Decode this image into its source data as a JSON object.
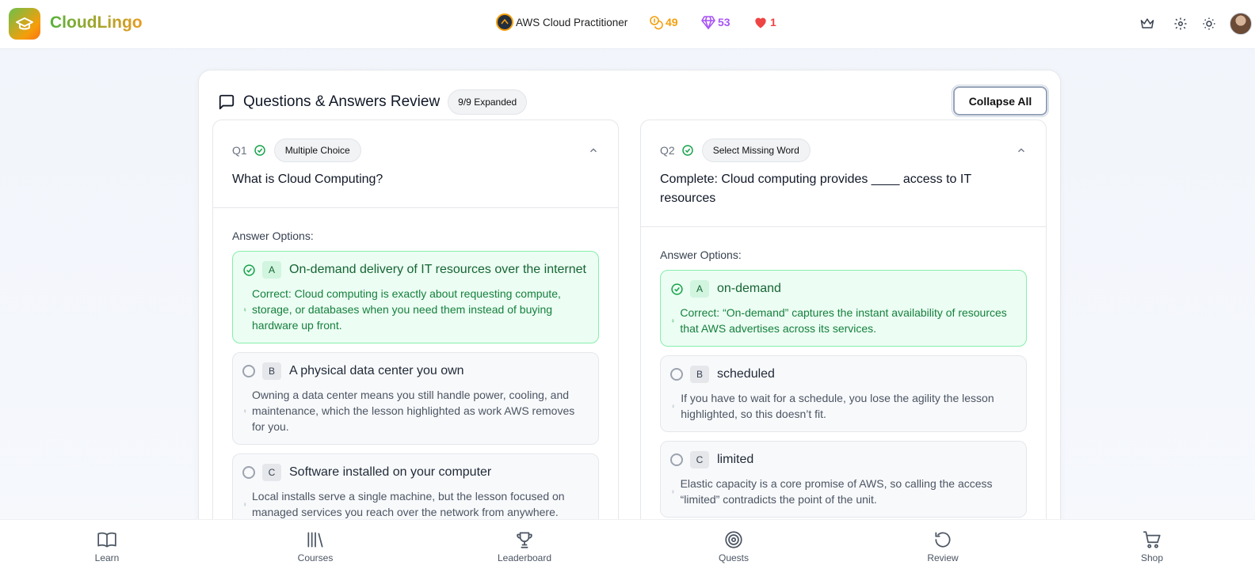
{
  "app": {
    "name": "CloudLingo"
  },
  "header": {
    "course": "AWS Cloud Practitioner",
    "coins": "49",
    "gems": "53",
    "hearts": "1"
  },
  "review": {
    "title": "Questions & Answers Review",
    "expanded_badge": "9/9 Expanded",
    "collapse_label": "Collapse All",
    "answers_label": "Answer Options:"
  },
  "questions": [
    {
      "num": "Q1",
      "type": "Multiple Choice",
      "text": "What is Cloud Computing?",
      "options": [
        {
          "letter": "A",
          "text": "On-demand delivery of IT resources over the internet",
          "correct": true,
          "explanation": "Correct: Cloud computing is exactly about requesting compute, storage, or databases when you need them instead of buying hardware up front."
        },
        {
          "letter": "B",
          "text": "A physical data center you own",
          "correct": false,
          "explanation": "Owning a data center means you still handle power, cooling, and maintenance, which the lesson highlighted as work AWS removes for you."
        },
        {
          "letter": "C",
          "text": "Software installed on your computer",
          "correct": false,
          "explanation": "Local installs serve a single machine, but the lesson focused on managed services you reach over the network from anywhere."
        }
      ]
    },
    {
      "num": "Q2",
      "type": "Select Missing Word",
      "text": "Complete: Cloud computing provides ____ access to IT resources",
      "options": [
        {
          "letter": "A",
          "text": "on-demand",
          "correct": true,
          "explanation": "Correct: “On-demand” captures the instant availability of resources that AWS advertises across its services."
        },
        {
          "letter": "B",
          "text": "scheduled",
          "correct": false,
          "explanation": "If you have to wait for a schedule, you lose the agility the lesson highlighted, so this doesn’t fit."
        },
        {
          "letter": "C",
          "text": "limited",
          "correct": false,
          "explanation": "Elastic capacity is a core promise of AWS, so calling the access “limited” contradicts the point of the unit."
        }
      ]
    }
  ],
  "nav": [
    {
      "label": "Learn",
      "icon": "book-icon"
    },
    {
      "label": "Courses",
      "icon": "library-icon"
    },
    {
      "label": "Leaderboard",
      "icon": "trophy-icon"
    },
    {
      "label": "Quests",
      "icon": "target-icon"
    },
    {
      "label": "Review",
      "icon": "refresh-icon"
    },
    {
      "label": "Shop",
      "icon": "cart-icon"
    }
  ],
  "colors": {
    "correct_bg": "#ecfdf3",
    "correct_text": "#166534",
    "coins": "#f59e0b",
    "gems": "#a855f7",
    "hearts": "#ef4444"
  }
}
